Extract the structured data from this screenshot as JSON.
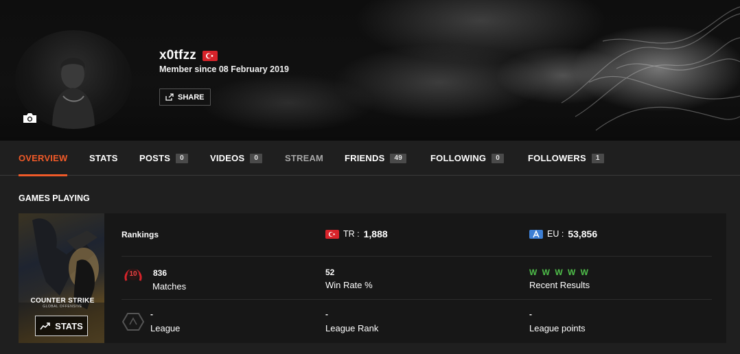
{
  "profile": {
    "username": "x0tfzz",
    "member_since": "Member since 08 February 2019",
    "share_label": "SHARE"
  },
  "nav": {
    "tabs": [
      {
        "label": "OVERVIEW"
      },
      {
        "label": "STATS"
      },
      {
        "label": "POSTS",
        "count": "0"
      },
      {
        "label": "VIDEOS",
        "count": "0"
      },
      {
        "label": "STREAM"
      },
      {
        "label": "FRIENDS",
        "count": "49"
      },
      {
        "label": "FOLLOWING",
        "count": "0"
      },
      {
        "label": "FOLLOWERS",
        "count": "1"
      }
    ]
  },
  "games": {
    "title": "GAMES PLAYING",
    "game": {
      "name": "COUNTER STRIKE",
      "subtitle": "GLOBAL OFFENSIVE",
      "stats_button": "STATS",
      "rankings_label": "Rankings",
      "tr_label": "TR :",
      "tr_value": "1,888",
      "eu_label": "EU :",
      "eu_value": "53,856",
      "level": "10",
      "matches_value": "836",
      "matches_label": "Matches",
      "winrate_value": "52",
      "winrate_label": "Win Rate %",
      "recent_value": "W W W W W",
      "recent_label": "Recent Results",
      "league_value": "-",
      "league_label": "League",
      "league_rank_value": "-",
      "league_rank_label": "League Rank",
      "league_points_value": "-",
      "league_points_label": "League points"
    }
  },
  "colors": {
    "accent": "#f05a28",
    "win": "#4fbf4a",
    "flag_tr": "#d8232a",
    "eu_badge": "#3d7fd4"
  }
}
